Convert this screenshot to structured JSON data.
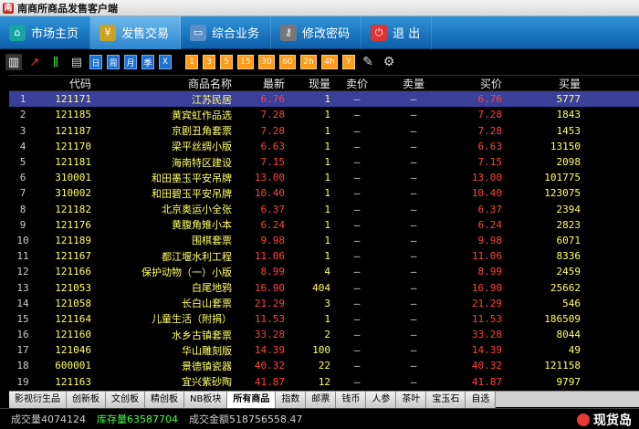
{
  "window": {
    "title": "南商所商品发售客户端"
  },
  "menu": [
    {
      "label": "市场主页",
      "icon": "home-icon",
      "active": false
    },
    {
      "label": "发售交易",
      "icon": "money-bag-icon",
      "active": true
    },
    {
      "label": "综合业务",
      "icon": "monitor-icon",
      "active": false
    },
    {
      "label": "修改密码",
      "icon": "key-icon",
      "active": false
    },
    {
      "label": "退   出",
      "icon": "power-icon",
      "active": false
    }
  ],
  "toolbar": {
    "periods": [
      "日",
      "周",
      "月",
      "季",
      "X"
    ],
    "minutes": [
      "1",
      "3",
      "5",
      "15",
      "30",
      "60",
      "2h",
      "4h",
      "Y"
    ]
  },
  "table": {
    "headers": [
      "",
      "代码",
      "商品名称",
      "最新",
      "现量",
      "卖价",
      "卖量",
      "买价",
      "买量"
    ],
    "rows": [
      [
        "1",
        "121171",
        "江苏民居",
        "6.76",
        "1",
        "—",
        "—",
        "6.76",
        "5777"
      ],
      [
        "2",
        "121185",
        "黄宾虹作品选",
        "7.28",
        "1",
        "—",
        "—",
        "7.28",
        "1843"
      ],
      [
        "3",
        "121187",
        "京剧丑角套票",
        "7.28",
        "1",
        "—",
        "—",
        "7.28",
        "1453"
      ],
      [
        "4",
        "121170",
        "梁平丝绸小版",
        "6.63",
        "1",
        "—",
        "—",
        "6.63",
        "13150"
      ],
      [
        "5",
        "121181",
        "海南特区建设",
        "7.15",
        "1",
        "—",
        "—",
        "7.15",
        "2098"
      ],
      [
        "6",
        "310001",
        "和田墨玉平安吊牌",
        "13.00",
        "1",
        "—",
        "—",
        "13.00",
        "101775"
      ],
      [
        "7",
        "310002",
        "和田碧玉平安吊牌",
        "10.40",
        "1",
        "—",
        "—",
        "10.40",
        "123075"
      ],
      [
        "8",
        "121182",
        "北京奥运小全张",
        "6.37",
        "1",
        "—",
        "—",
        "6.37",
        "2394"
      ],
      [
        "9",
        "121176",
        "黄腹角雉小本",
        "6.24",
        "1",
        "—",
        "—",
        "6.24",
        "2823"
      ],
      [
        "10",
        "121189",
        "围棋套票",
        "9.98",
        "1",
        "—",
        "—",
        "9.98",
        "6071"
      ],
      [
        "11",
        "121167",
        "都江堰水利工程",
        "11.06",
        "1",
        "—",
        "—",
        "11.06",
        "8336"
      ],
      [
        "12",
        "121166",
        "保护动物（一）小版",
        "8.99",
        "4",
        "—",
        "—",
        "8.99",
        "2459"
      ],
      [
        "13",
        "121053",
        "白尾地鸦",
        "16.90",
        "404",
        "—",
        "—",
        "16.90",
        "25662"
      ],
      [
        "14",
        "121058",
        "长白山套票",
        "21.29",
        "3",
        "—",
        "—",
        "21.29",
        "546"
      ],
      [
        "15",
        "121164",
        "儿童生活（附捐）",
        "11.53",
        "1",
        "—",
        "—",
        "11.53",
        "186509"
      ],
      [
        "16",
        "121160",
        "水乡古镇套票",
        "33.28",
        "2",
        "—",
        "—",
        "33.28",
        "8044"
      ],
      [
        "17",
        "121046",
        "华山雕刻版",
        "14.39",
        "100",
        "—",
        "—",
        "14.39",
        "49"
      ],
      [
        "18",
        "600001",
        "景德镇瓷器",
        "40.32",
        "22",
        "—",
        "—",
        "40.32",
        "121158"
      ],
      [
        "19",
        "121163",
        "宜兴紫砂陶",
        "41.87",
        "12",
        "—",
        "—",
        "41.87",
        "9797"
      ]
    ]
  },
  "tabs": [
    "影视衍生品",
    "创新板",
    "文创板",
    "精创板",
    "NB板块",
    "所有商品",
    "指数",
    "邮票",
    "钱币",
    "人参",
    "茶叶",
    "宝玉石",
    "自选"
  ],
  "status": {
    "vol_label": "成交量",
    "vol": "4074124",
    "stock_label": "库存量",
    "stock": "63587704",
    "amount_label": "成交金额",
    "amount": "518756558.47",
    "watermark": "现货岛"
  }
}
